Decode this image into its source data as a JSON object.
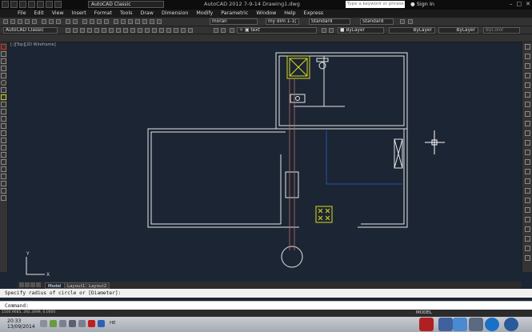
{
  "title_bar": {
    "workspace": "AutoCAD Classic",
    "app_title": "AutoCAD 2012",
    "file_name": "7-9-14 Drawing1.dwg",
    "search_placeholder": "Type a keyword or phrase",
    "sign_in": "Sign In"
  },
  "menu": {
    "items": [
      "File",
      "Edit",
      "View",
      "Insert",
      "Format",
      "Tools",
      "Draw",
      "Dimension",
      "Modify",
      "Parametric",
      "Window",
      "Help",
      "Express"
    ]
  },
  "toolbar": {
    "layer": "moran",
    "dimstyle": "my dim 1-1(",
    "textstyle": "Standard",
    "tablestyle": "Standard",
    "workspace_combo": "AutoCAD Classic",
    "text_layer": "text",
    "color": "ByLayer",
    "linetype": "ByLayer",
    "lineweight": "ByLayer",
    "plotstyle": "ByColor"
  },
  "viewport": {
    "label": "[-][Top][2D Wireframe]",
    "ucs_x": "X",
    "ucs_y": "Y"
  },
  "tabs": [
    "Model",
    "Layout1",
    "Layout2"
  ],
  "command": {
    "history": "Specify radius of circle or [Diameter]:",
    "prompt": "Command:"
  },
  "status": {
    "coords": "1500.9685, 292.3699, 0.0000",
    "space": "MODEL"
  },
  "taskbar": {
    "time": "20:33",
    "date": "13/09/2014",
    "language": "HE"
  },
  "colors": {
    "canvas": "#1c2533",
    "walls": "#e6e6e6",
    "fixture_highlight": "#d8d826",
    "hatch_line": "#c06a6a",
    "blue_line": "#2850b0"
  }
}
